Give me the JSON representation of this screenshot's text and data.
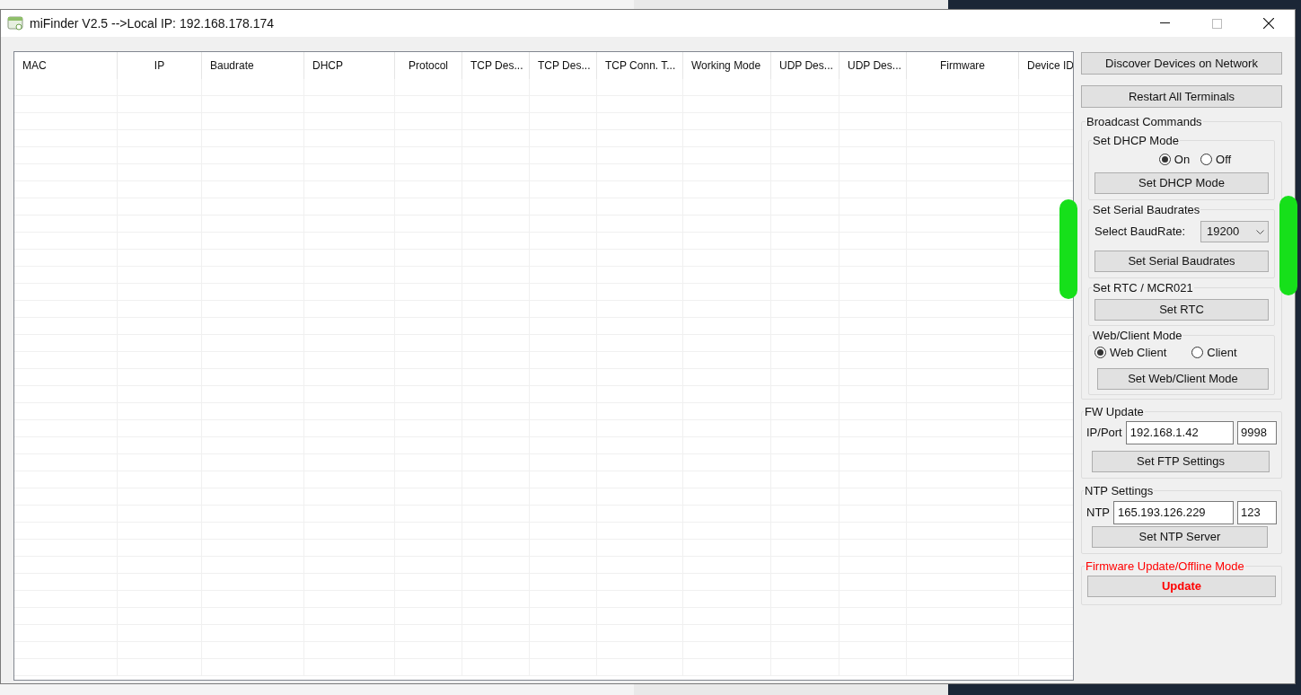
{
  "window": {
    "title": "miFinder V2.5 -->Local IP: 192.168.178.174"
  },
  "table": {
    "columns": [
      "MAC",
      "IP",
      "Baudrate",
      "DHCP",
      "Protocol",
      "TCP Des...",
      "TCP Des...",
      "TCP Conn. T...",
      "Working Mode",
      "UDP Des...",
      "UDP Des...",
      "Firmware",
      "Device ID"
    ]
  },
  "actions": [
    "Discover Devices on Network",
    "Restart All Terminals"
  ],
  "broadcast": {
    "title": "Broadcast Commands",
    "dhcp": {
      "title": "Set DHCP Mode",
      "options": [
        {
          "label": "On",
          "selected": true
        },
        {
          "label": "Off",
          "selected": false
        }
      ],
      "button": "Set DHCP Mode"
    },
    "baud": {
      "title": "Set Serial Baudrates",
      "label": "Select BaudRate:",
      "value": "19200",
      "button": "Set Serial Baudrates"
    },
    "rtc": {
      "title": "Set RTC / MCR021",
      "button": "Set RTC"
    },
    "web_client": {
      "title": "Web/Client Mode",
      "options": [
        {
          "label": "Web Client",
          "selected": true
        },
        {
          "label": "Client",
          "selected": false
        }
      ],
      "button": "Set Web/Client Mode"
    }
  },
  "fw_update": {
    "title": "FW Update",
    "label": "IP/Port",
    "ip": "192.168.1.42",
    "port": "9998",
    "button": "Set FTP Settings"
  },
  "ntp": {
    "title": "NTP Settings",
    "label": "NTP",
    "ip": "165.193.126.229",
    "port": "123",
    "button": "Set NTP Server"
  },
  "offline": {
    "title": "Firmware Update/Offline Mode",
    "button": "Update"
  }
}
